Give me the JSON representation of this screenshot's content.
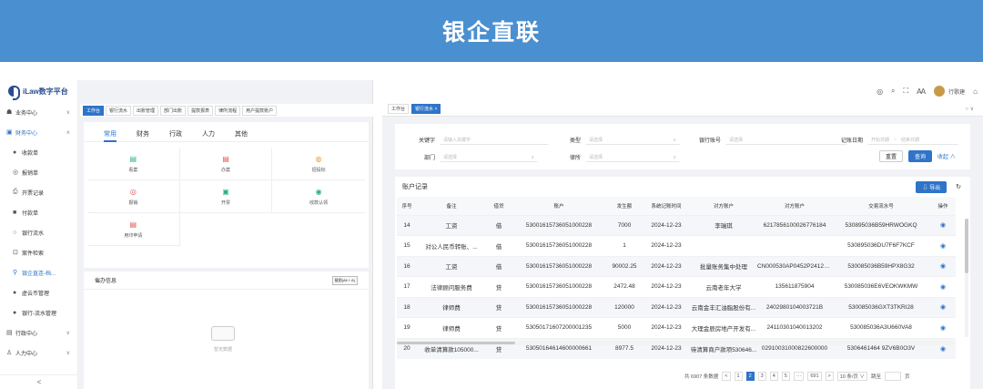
{
  "banner": {
    "title": "银企直联"
  },
  "left_app": {
    "logo_text": "iLaw数字平台",
    "nav": [
      {
        "label": "业务中心",
        "icon": "structure-icon",
        "chevron": "∨",
        "state": "normal",
        "level": "top"
      },
      {
        "label": "财务中心",
        "icon": "finance-icon",
        "chevron": "∧",
        "state": "active",
        "level": "top"
      },
      {
        "label": "收款单",
        "icon": "dot-icon",
        "chevron": "",
        "state": "normal",
        "level": "sub"
      },
      {
        "label": "报销单",
        "icon": "target-icon",
        "chevron": "",
        "state": "normal",
        "level": "sub"
      },
      {
        "label": "开票记录",
        "icon": "invoice-icon",
        "chevron": "",
        "state": "normal",
        "level": "sub"
      },
      {
        "label": "付款单",
        "icon": "square-icon",
        "chevron": "",
        "state": "normal",
        "level": "sub"
      },
      {
        "label": "银行流水",
        "icon": "ring-icon",
        "chevron": "",
        "state": "normal",
        "level": "sub"
      },
      {
        "label": "案件检索",
        "icon": "search-box-icon",
        "chevron": "",
        "state": "normal",
        "level": "sub"
      },
      {
        "label": "银企直连-档...",
        "icon": "link-icon",
        "chevron": "",
        "state": "active",
        "level": "sub"
      },
      {
        "label": "虚云币管理",
        "icon": "dot-icon",
        "chevron": "",
        "state": "normal",
        "level": "sub"
      },
      {
        "label": "银行-流水管理",
        "icon": "dot-icon",
        "chevron": "",
        "state": "normal",
        "level": "sub"
      },
      {
        "label": "行政中心",
        "icon": "doc-icon",
        "chevron": "∨",
        "state": "normal",
        "level": "top"
      },
      {
        "label": "人力中心",
        "icon": "person-icon",
        "chevron": "∨",
        "state": "normal",
        "level": "top"
      }
    ],
    "collapse": "<",
    "tabs": [
      "工作台",
      "银行流水",
      "出账管理",
      "部门出账",
      "提款报表",
      "律所流程",
      "用户提款账户"
    ],
    "active_tab": 0,
    "categories": [
      "常用",
      "财务",
      "行政",
      "人力",
      "其他"
    ],
    "active_category": 0,
    "quick_items": [
      {
        "label": "看案",
        "icon": "▤",
        "color": "#2bb07e"
      },
      {
        "label": "办案",
        "icon": "▤",
        "color": "#e05555"
      },
      {
        "label": "招投标",
        "icon": "◍",
        "color": "#e8a13a"
      },
      {
        "label": "报销",
        "icon": "◎",
        "color": "#e05555"
      },
      {
        "label": "开票",
        "icon": "▣",
        "color": "#2bb07e"
      },
      {
        "label": "收款认领",
        "icon": "◉",
        "color": "#2bb07e"
      },
      {
        "label": "用印申请",
        "icon": "▤",
        "color": "#e05555"
      }
    ],
    "todo_title": "催办信息",
    "todo_shortcut": "截图(Alt + A)",
    "empty_text": "暂无数据"
  },
  "right_app": {
    "topbar": {
      "icons": [
        "◎",
        "⌕",
        "⛶",
        "Ꜳ"
      ],
      "user_name": "行歌建",
      "home_icon": "⌂"
    },
    "tabs": [
      "工作台",
      "银行流水 ×"
    ],
    "active_tab": 1,
    "tab_controls": "○  ∨",
    "filters": {
      "keyword_label": "关键字",
      "keyword_placeholder": "请输入关键字",
      "type_label": "类型",
      "type_placeholder": "请选择",
      "account_label": "银行账号",
      "account_placeholder": "请选择",
      "date_label": "记账日期",
      "date_start": "开始日期",
      "date_sep": "~",
      "date_end": "结束日期",
      "dept_label": "部门",
      "dept_placeholder": "请选择",
      "lawyer_label": "律所",
      "lawyer_placeholder": "请选择",
      "reset": "重置",
      "search": "查询",
      "collapse": "收起 ∧"
    },
    "records": {
      "title": "账户记录",
      "export": "⇩ 导出",
      "refresh": "↻",
      "columns": [
        "序号",
        "备注",
        "借贷",
        "账户",
        "发生额",
        "系统记账时间",
        "对方账户",
        "对方账户",
        "交易流水号",
        "操作"
      ],
      "rows": [
        [
          "14",
          "工资",
          "借",
          "53001615736051000228",
          "7000",
          "2024-12-23",
          "李瑞琪",
          "6217856100026776184",
          "530895036B59HRWOGKQ",
          "◉"
        ],
        [
          "15",
          "对公人民币转账、...",
          "借",
          "53001615736051000228",
          "1",
          "2024-12-23",
          "",
          "",
          "530895036DU7F6F7KCF",
          "◉"
        ],
        [
          "16",
          "工资",
          "借",
          "53001615736051000228",
          "90002.25",
          "2024-12-23",
          "批量账务集中处理",
          "CN000530AP0452P24122...",
          "530085036B59HPX8G32",
          "◉"
        ],
        [
          "17",
          "法律顾问服务费",
          "贷",
          "53001615736051000228",
          "2472.48",
          "2024-12-23",
          "云南老年大学",
          "135611875904",
          "530085036E6VEOKWKMW",
          "◉"
        ],
        [
          "18",
          "律师费",
          "贷",
          "53001615736051000228",
          "120000",
          "2024-12-23",
          "云南金丰汇油脂股份有...",
          "2402980104003721B",
          "530085036GXT3TKRI28",
          "◉"
        ],
        [
          "19",
          "律师费",
          "贷",
          "53050171607200001235",
          "5000",
          "2024-12-23",
          "大理金辰房地产开发有...",
          "24110301040013202",
          "530085036A3U660VA8",
          "◉"
        ],
        [
          "20",
          "收单清算款105000...",
          "贷",
          "53050164614600000661",
          "8977.5",
          "2024-12-23",
          "待清算商户款项530646...",
          "02910031000822600000",
          "5306461464 9ZV6B0O3V",
          "◉"
        ]
      ]
    },
    "pager": {
      "total": "共 6907 条数据",
      "prev": "<",
      "pages": [
        "1",
        "2",
        "3",
        "4",
        "5",
        "···",
        "691",
        ">"
      ],
      "active_page": "2",
      "page_size": "10 条/页 ∨",
      "goto_label": "跳至",
      "goto_suffix": "页"
    }
  }
}
